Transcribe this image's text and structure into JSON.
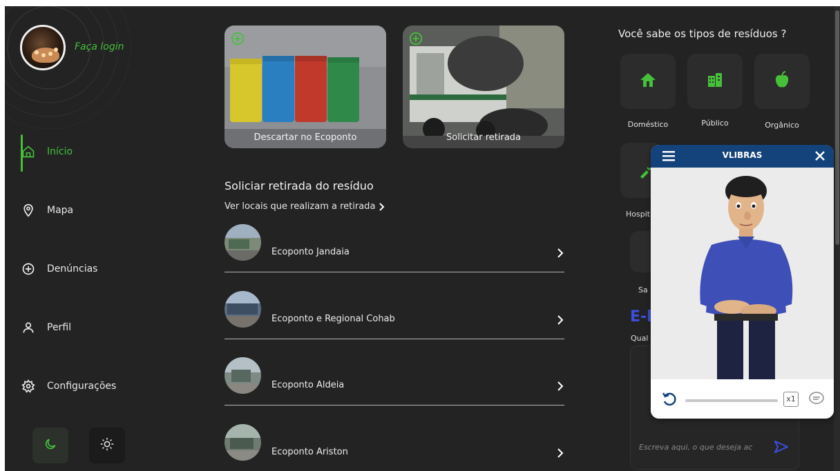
{
  "sidebar": {
    "login_label": "Faça login",
    "nav": [
      {
        "label": "Início",
        "icon": "home-icon",
        "active": true
      },
      {
        "label": "Mapa",
        "icon": "map-pin-icon",
        "active": false
      },
      {
        "label": "Denúncias",
        "icon": "plus-circle-icon",
        "active": false
      },
      {
        "label": "Perfil",
        "icon": "user-icon",
        "active": false
      },
      {
        "label": "Configurações",
        "icon": "gear-icon",
        "active": false
      }
    ],
    "theme_dark_icon": "moon-icon",
    "theme_light_icon": "sun-icon"
  },
  "cards": [
    {
      "caption": "Descartar no Ecoponto",
      "icon": "plus-circle-icon"
    },
    {
      "caption": "Solicitar retirada",
      "icon": "plus-circle-icon"
    }
  ],
  "section": {
    "title": "Soliciar retirada do resíduo",
    "link": "Ver locais que realizam a retirada"
  },
  "ecopontos": [
    {
      "name": "Ecoponto Jandaia"
    },
    {
      "name": "Ecoponto e Regional Cohab"
    },
    {
      "name": "Ecoponto Aldeia"
    },
    {
      "name": "Ecoponto Ariston"
    }
  ],
  "waste_types": {
    "title": "Você sabe os tipos de resíduos ?",
    "items": [
      {
        "label": "Doméstico",
        "icon": "house-icon"
      },
      {
        "label": "Público",
        "icon": "buildings-icon"
      },
      {
        "label": "Orgânico",
        "icon": "apple-icon"
      }
    ],
    "partial_labels": [
      "Hospit",
      "Sa",
      "Qual"
    ],
    "partial_heading": "E-l"
  },
  "chat": {
    "placeholder": "Escreva aqui, o que deseja ac"
  },
  "vlibras": {
    "title": "VLIBRAS",
    "speed": "x1"
  },
  "colors": {
    "accent": "#46c03a",
    "background": "#232323",
    "vlibras_header": "#14427a",
    "link_blue": "#3b4fe0"
  }
}
